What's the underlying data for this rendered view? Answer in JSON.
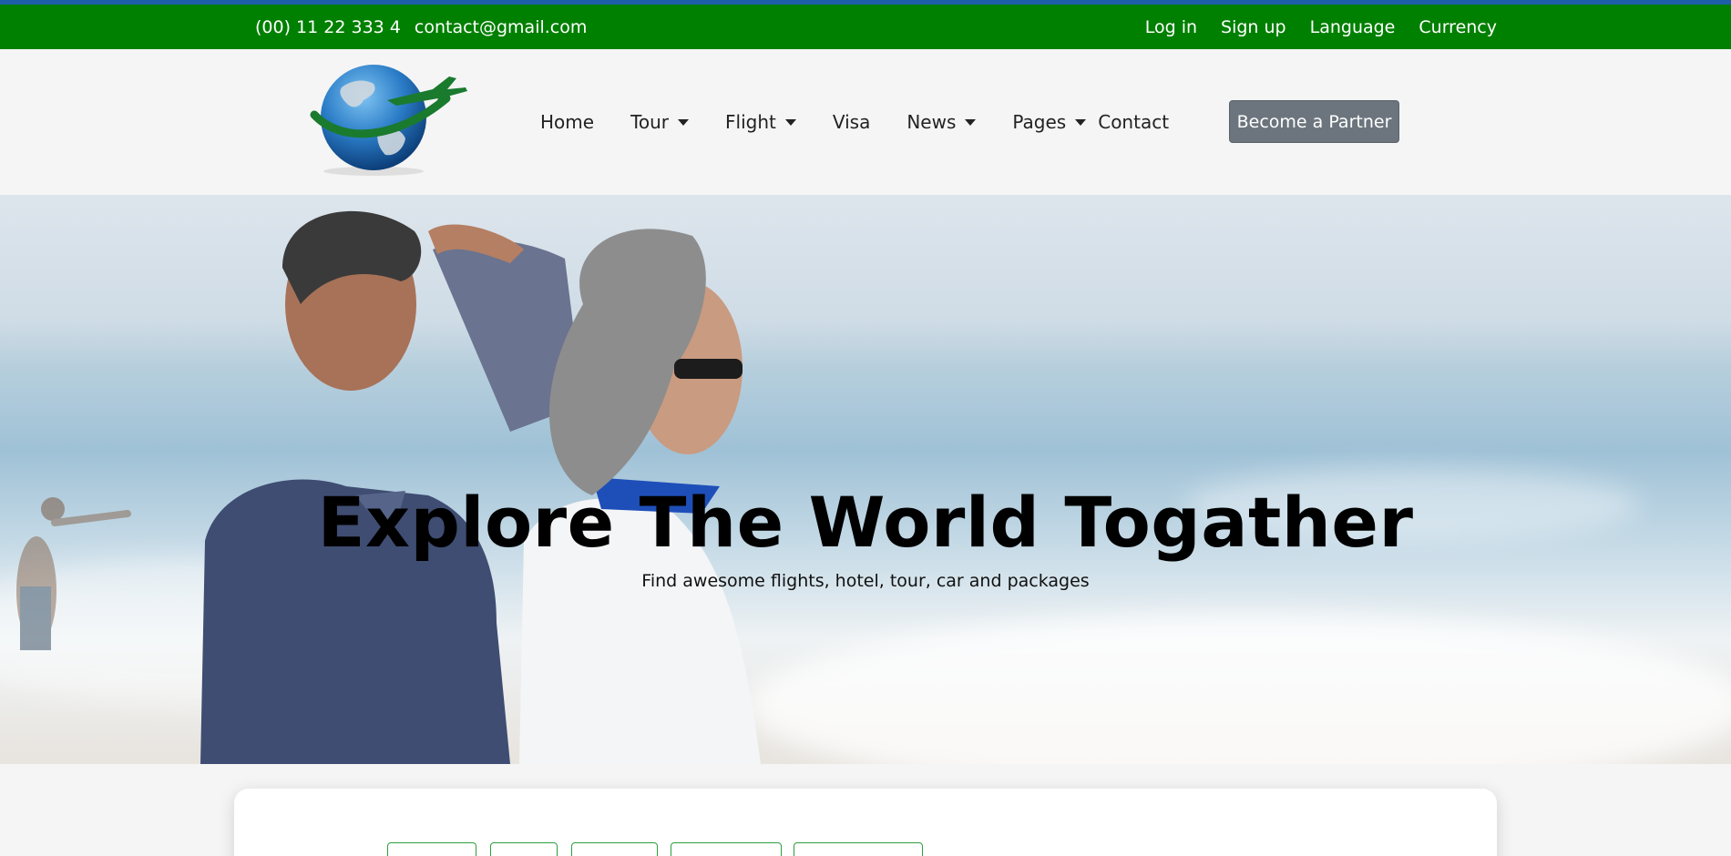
{
  "topbar": {
    "phone": "(00) 11 22 333 4",
    "email": "contact@gmail.com",
    "links": [
      {
        "label": "Log in"
      },
      {
        "label": "Sign up"
      },
      {
        "label": "Language"
      },
      {
        "label": "Currency"
      }
    ]
  },
  "nav": {
    "items": [
      {
        "label": "Home",
        "dropdown": false
      },
      {
        "label": "Tour",
        "dropdown": true
      },
      {
        "label": "Flight",
        "dropdown": true
      },
      {
        "label": "Visa",
        "dropdown": false
      },
      {
        "label": "News",
        "dropdown": true
      },
      {
        "label": "Pages",
        "dropdown": true
      },
      {
        "label": "Contact",
        "dropdown": false
      }
    ],
    "cta": "Become a Partner"
  },
  "hero": {
    "title": "Explore The World Togather",
    "subtitle": "Find awesome flights, hotel, tour, car and packages"
  },
  "colors": {
    "topbar": "#008000",
    "accent_line": "#1d5fa6",
    "cta_bg": "#6c757d",
    "tab_border": "#2e9e3e"
  }
}
